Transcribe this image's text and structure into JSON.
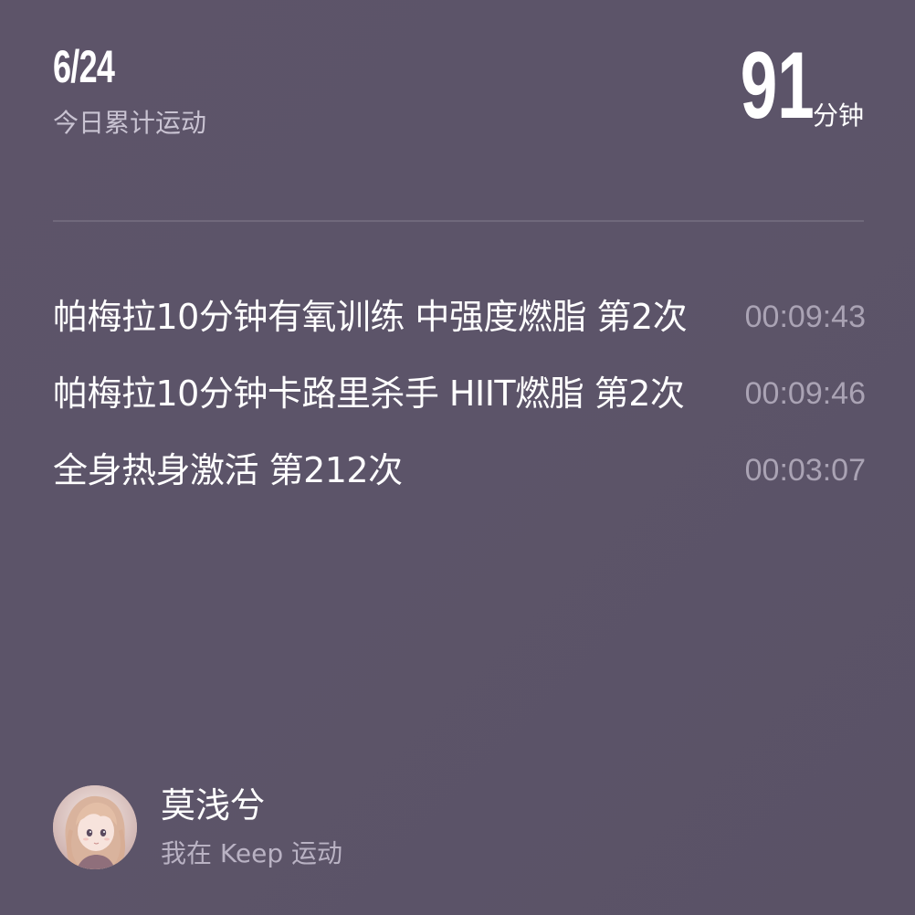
{
  "header": {
    "date": "6/24",
    "subtitle": "今日累计运动",
    "total_value": "91",
    "total_unit": "分钟"
  },
  "workouts": [
    {
      "title": "帕梅拉10分钟有氧训练 中强度燃脂 第2次",
      "duration": "00:09:43"
    },
    {
      "title": "帕梅拉10分钟卡路里杀手 HIIT燃脂 第2次",
      "duration": "00:09:46"
    },
    {
      "title": "全身热身激活 第212次",
      "duration": "00:03:07"
    }
  ],
  "profile": {
    "name": "莫浅兮",
    "tagline": "我在 Keep 运动",
    "avatar_icon": "avatar-anime-girl"
  },
  "colors": {
    "background": "#5c5469",
    "primary_text": "#ffffff",
    "secondary_text": "#aaa3b4"
  }
}
